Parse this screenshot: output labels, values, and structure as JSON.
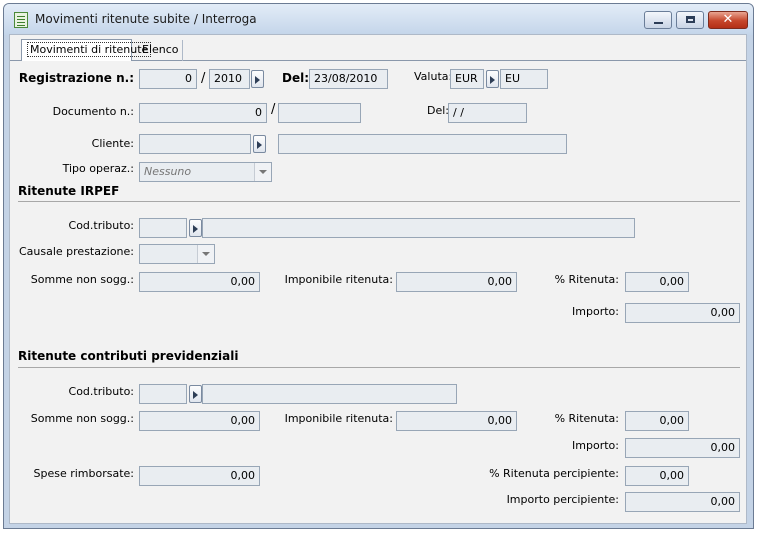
{
  "window": {
    "title": "Movimenti ritenute subite / Interroga",
    "controls": {
      "minimize": "minimize-icon",
      "maximize": "maximize-icon",
      "close": "close-icon"
    }
  },
  "tabs": [
    {
      "label": "Movimenti di ritenute",
      "active": true
    },
    {
      "label": "Elenco",
      "active": false
    }
  ],
  "header": {
    "registrazione_label": "Registrazione n.:",
    "registrazione_num": "0",
    "slash1": "/",
    "registrazione_year": "2010",
    "del_label": "Del:",
    "del_value": "23/08/2010",
    "valuta_label": "Valuta:",
    "valuta_code": "EUR",
    "valuta_desc": "EU",
    "documento_label": "Documento n.:",
    "documento_num": "0",
    "slash2": "/",
    "documento_series": "",
    "doc_del_label": "Del:",
    "doc_del_value": " /  /",
    "cliente_label": "Cliente:",
    "cliente_code": "",
    "cliente_desc": "",
    "tipo_label": "Tipo operaz.:",
    "tipo_value": "Nessuno"
  },
  "irpef": {
    "section_title": "Ritenute IRPEF",
    "cod_tributo_label": "Cod.tributo:",
    "cod_tributo_code": "",
    "cod_tributo_desc": "",
    "causale_label": "Causale prestazione:",
    "causale_value": "",
    "somme_label": "Somme non sogg.:",
    "somme_value": "0,00",
    "imponibile_label": "Imponibile ritenuta:",
    "imponibile_value": "0,00",
    "perc_label": "% Ritenuta:",
    "perc_value": "0,00",
    "importo_label": "Importo:",
    "importo_value": "0,00"
  },
  "contributi": {
    "section_title": "Ritenute contributi previdenziali",
    "cod_tributo_label": "Cod.tributo:",
    "cod_tributo_code": "",
    "cod_tributo_desc": "",
    "somme_label": "Somme non sogg.:",
    "somme_value": "0,00",
    "imponibile_label": "Imponibile ritenuta:",
    "imponibile_value": "0,00",
    "perc_label": "% Ritenuta:",
    "perc_value": "0,00",
    "importo_label": "Importo:",
    "importo_value": "0,00",
    "spese_label": "Spese rimborsate:",
    "spese_value": "0,00",
    "perc_percipiente_label": "% Ritenuta percipiente:",
    "perc_percipiente_value": "0,00",
    "importo_percipiente_label": "Importo percipiente:",
    "importo_percipiente_value": "0,00"
  }
}
